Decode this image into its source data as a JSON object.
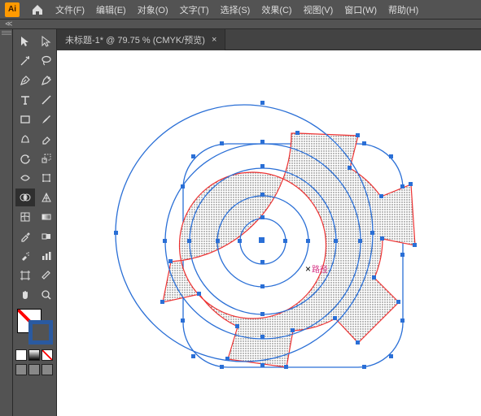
{
  "menu": {
    "items": [
      "文件(F)",
      "编辑(E)",
      "对象(O)",
      "文字(T)",
      "选择(S)",
      "效果(C)",
      "视图(V)",
      "窗口(W)",
      "帮助(H)"
    ]
  },
  "tab": {
    "label": "未标题-1* @ 79.75 % (CMYK/预览)"
  },
  "annotation": {
    "path_label": "路径"
  },
  "tools": [
    "selection",
    "direct-selection",
    "magic-wand",
    "lasso",
    "pen",
    "curvature",
    "type",
    "line",
    "rectangle",
    "paintbrush",
    "shaper",
    "eraser",
    "rotate",
    "scale",
    "width",
    "free-transform",
    "shape-builder",
    "perspective",
    "mesh",
    "gradient",
    "eyedropper",
    "blend",
    "symbol-sprayer",
    "column-graph",
    "artboard",
    "slice",
    "hand",
    "zoom"
  ]
}
